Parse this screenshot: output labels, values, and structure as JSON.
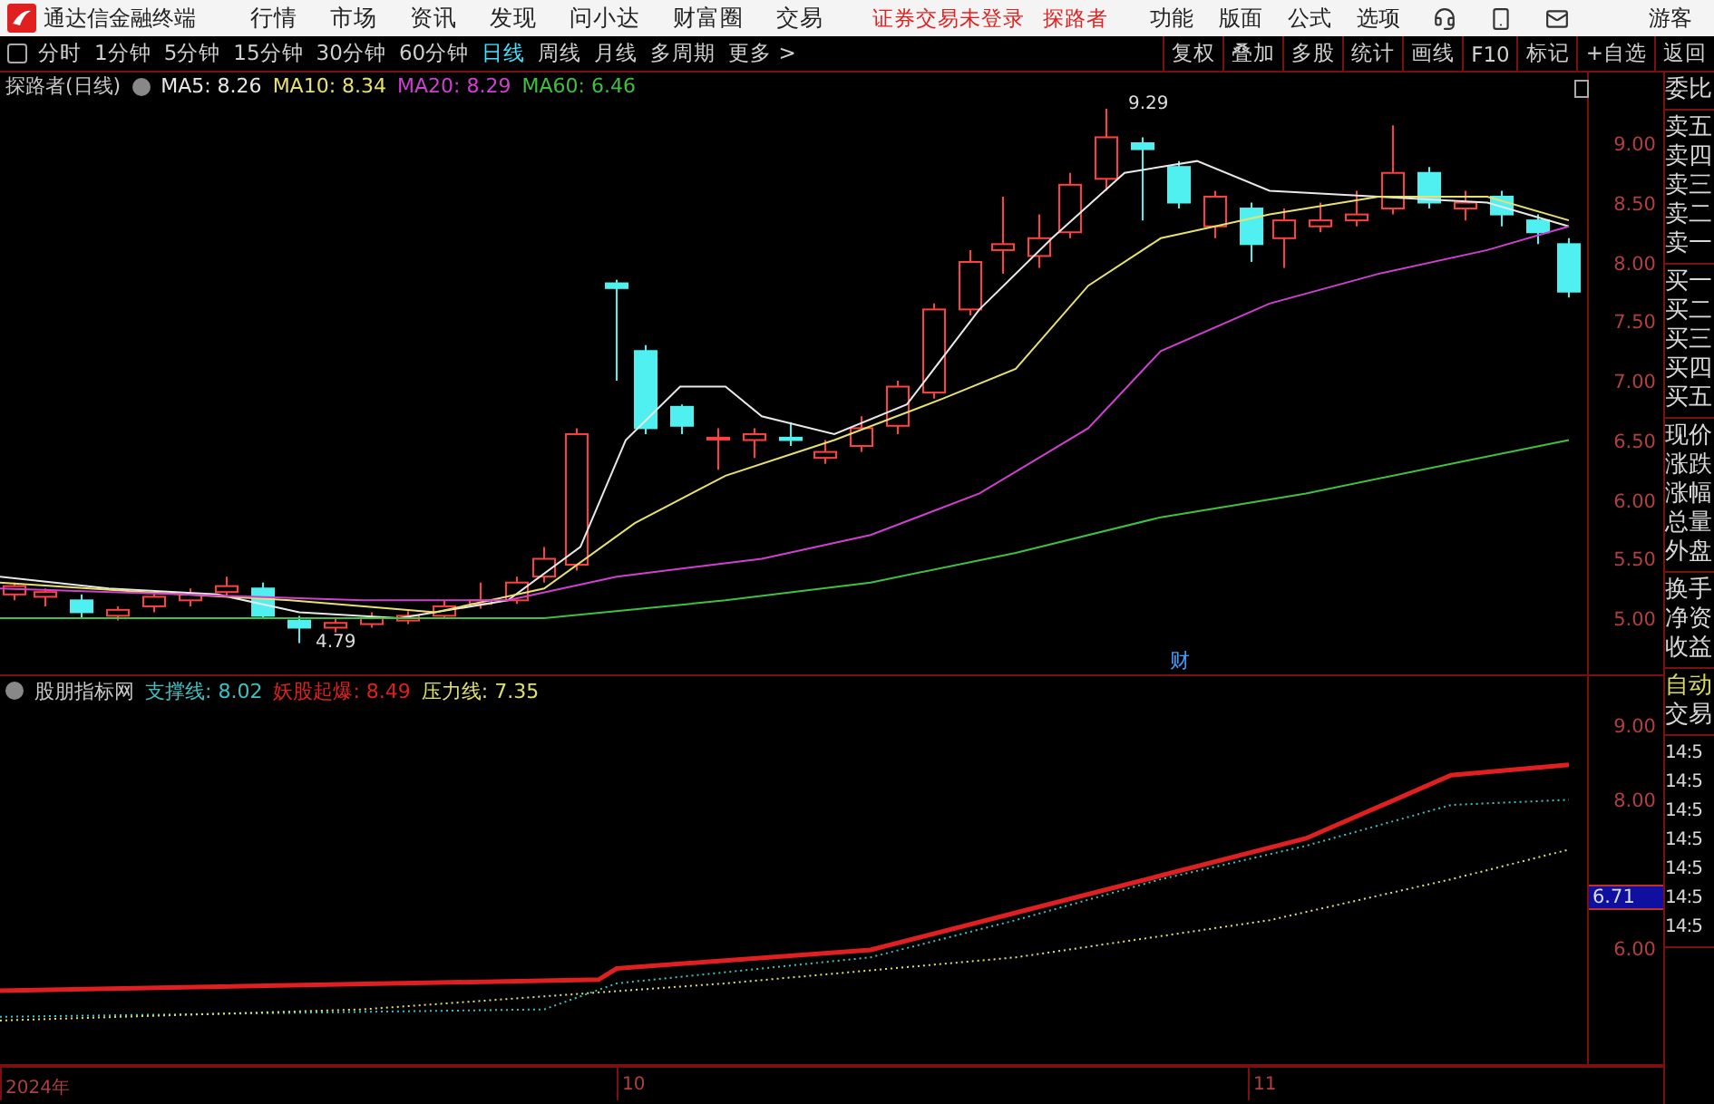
{
  "title_bar": {
    "app_name": "通达信金融终端",
    "menus": [
      "行情",
      "市场",
      "资讯",
      "发现",
      "问小达",
      "财富圈",
      "交易"
    ],
    "notice": "证券交易未登录",
    "stock": "探路者",
    "tools": [
      "功能",
      "版面",
      "公式",
      "选项"
    ],
    "user": "游客"
  },
  "period_tabs": [
    {
      "label": "分时",
      "selected": false
    },
    {
      "label": "1分钟",
      "selected": false
    },
    {
      "label": "5分钟",
      "selected": false
    },
    {
      "label": "15分钟",
      "selected": false
    },
    {
      "label": "30分钟",
      "selected": false
    },
    {
      "label": "60分钟",
      "selected": false
    },
    {
      "label": "日线",
      "selected": true
    },
    {
      "label": "周线",
      "selected": false
    },
    {
      "label": "月线",
      "selected": false
    },
    {
      "label": "多周期",
      "selected": false
    },
    {
      "label": "更多 >",
      "selected": false
    }
  ],
  "toolbar_buttons": [
    "复权",
    "叠加",
    "多股",
    "统计",
    "画线",
    "F10",
    "标记",
    "+自选",
    "返回"
  ],
  "main_chart": {
    "title": "探路者(日线)",
    "moving_averages": [
      {
        "label": "MA5: 8.26",
        "color": "#e8e8e8"
      },
      {
        "label": "MA10: 8.34",
        "color": "#e8e070"
      },
      {
        "label": "MA20: 8.29",
        "color": "#d040d0"
      },
      {
        "label": "MA60: 6.46",
        "color": "#40c040"
      }
    ],
    "price_ticks": [
      "9.00",
      "8.50",
      "8.00",
      "7.50",
      "7.00",
      "6.50",
      "6.00",
      "5.50",
      "5.00"
    ],
    "high_label": "9.29",
    "low_label": "4.79",
    "event_marker": "财"
  },
  "indicator_chart": {
    "title": "股朋指标网",
    "lines": [
      {
        "label": "支撑线: 8.02",
        "color": "#40c0c0"
      },
      {
        "label": "妖股起爆: 8.49",
        "color": "#e02020"
      },
      {
        "label": "压力线: 7.35",
        "color": "#e0e070"
      }
    ],
    "ticks": [
      "9.00",
      "8.00",
      "6.00"
    ],
    "current_value": "6.71"
  },
  "date_axis": [
    "2024年",
    "10",
    "11"
  ],
  "side_panel": [
    [
      "委比"
    ],
    [
      "卖五",
      "卖四",
      "卖三",
      "卖二",
      "卖一"
    ],
    [
      "买一",
      "买二",
      "买三",
      "买四",
      "买五"
    ],
    [
      "现价",
      "涨跌",
      "涨幅",
      "总量",
      "外盘"
    ],
    [
      "换手",
      "净资",
      "收益"
    ],
    [
      "自动",
      "交易"
    ],
    [
      "14:5",
      "14:5",
      "14:5",
      "14:5",
      "14:5",
      "14:5",
      "14:5"
    ]
  ]
}
